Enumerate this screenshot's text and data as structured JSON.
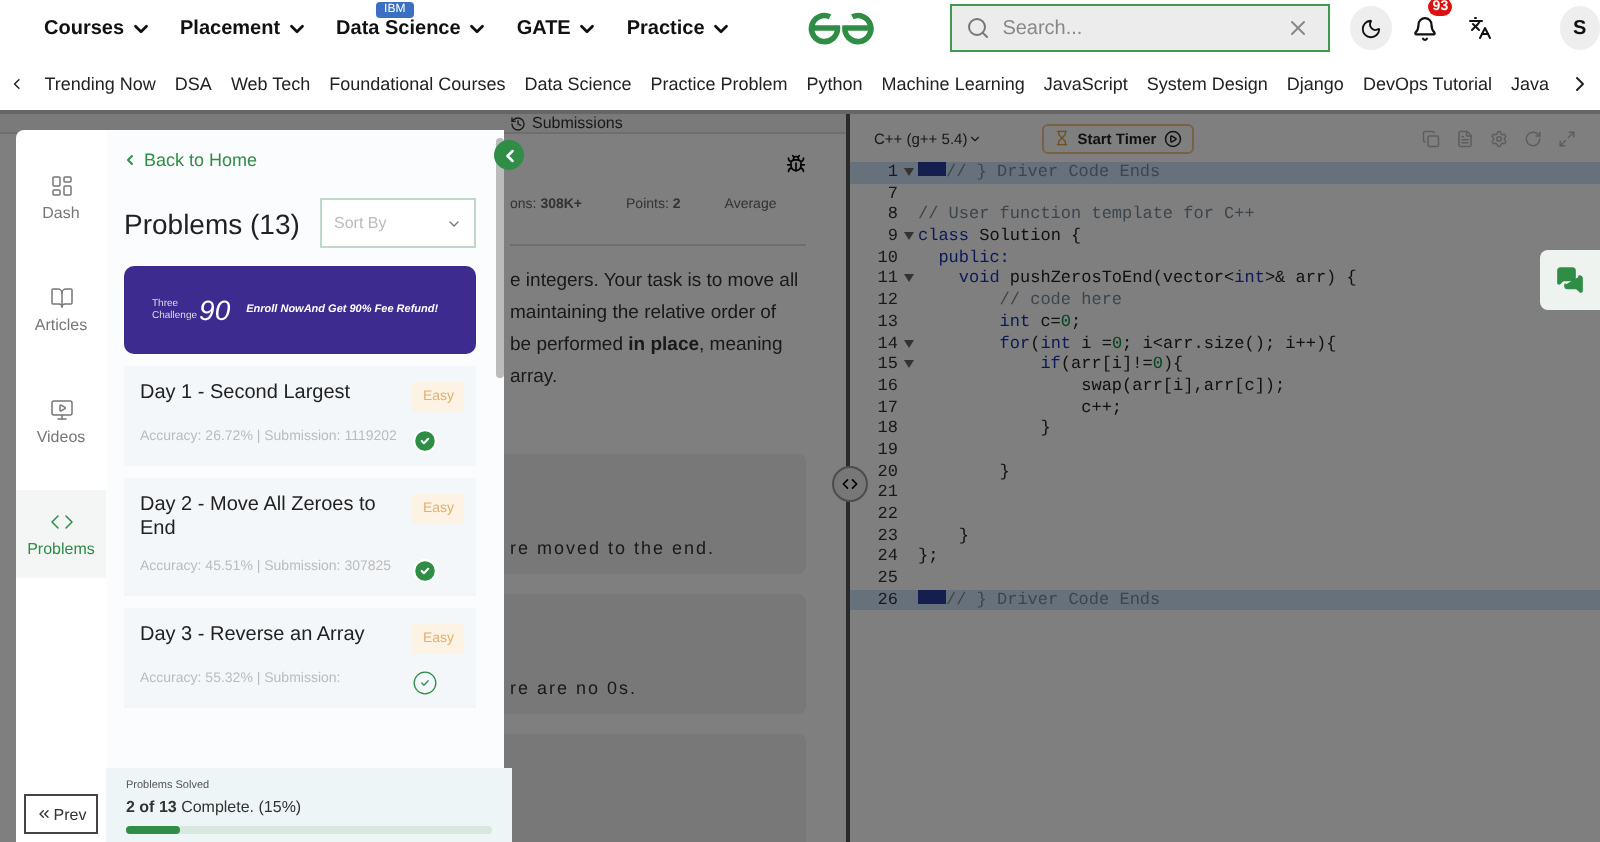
{
  "header": {
    "nav": [
      {
        "label": "Courses"
      },
      {
        "label": "Placement"
      },
      {
        "label": "Data Science",
        "badge": "IBM"
      },
      {
        "label": "GATE"
      },
      {
        "label": "Practice"
      }
    ],
    "search": {
      "placeholder": "Search..."
    },
    "notifications": "93",
    "avatar": "S"
  },
  "topics": [
    "Trending Now",
    "DSA",
    "Web Tech",
    "Foundational Courses",
    "Data Science",
    "Practice Problem",
    "Python",
    "Machine Learning",
    "JavaScript",
    "System Design",
    "Django",
    "DevOps Tutorial",
    "Java"
  ],
  "problem_panel": {
    "tab": "Submissions",
    "stats": [
      "ons: **308K+**",
      "Points: **2**",
      "Average"
    ],
    "description": [
      "e integers. Your task is to move all",
      "maintaining the relative order of",
      "be performed **in place**, meaning",
      "array."
    ],
    "examples": [
      {
        "kind": "text",
        "text": "re moved to the end."
      },
      {
        "kind": "text",
        "text": "re are no 0s."
      },
      {
        "kind": "empty"
      }
    ]
  },
  "editor": {
    "language": "C++ (g++ 5.4)",
    "timer": "Start Timer",
    "lines": [
      {
        "number": "1",
        "fold": true,
        "marker": true,
        "highlighted": true,
        "tokens": [
          {
            "text": "// } Driver Code Ends",
            "kind": "comment"
          }
        ]
      },
      {
        "number": "7",
        "fold": false,
        "marker": false,
        "highlighted": false
      },
      {
        "number": "8",
        "fold": false,
        "marker": false,
        "highlighted": false,
        "tokens": [
          {
            "text": "// User function template for C++",
            "kind": "comment"
          }
        ]
      },
      {
        "number": "9",
        "fold": true,
        "marker": false,
        "highlighted": false,
        "tokens": [
          {
            "text": "class",
            "kind": "keyword"
          },
          {
            "text": " Solution {",
            "kind": "plain"
          }
        ]
      },
      {
        "number": "10",
        "fold": false,
        "marker": false,
        "highlighted": false,
        "tokens": [
          {
            "text": "  public:",
            "kind": "keyword"
          }
        ]
      },
      {
        "number": "11",
        "fold": true,
        "marker": false,
        "highlighted": false,
        "tokens": [
          {
            "text": "    void",
            "kind": "keyword"
          },
          {
            "text": " pushZerosToEnd(vector<",
            "kind": "plain"
          },
          {
            "text": "int",
            "kind": "keyword"
          },
          {
            "text": ">& arr) {",
            "kind": "plain"
          }
        ]
      },
      {
        "number": "12",
        "fold": false,
        "marker": false,
        "highlighted": false,
        "tokens": [
          {
            "text": "        // code here",
            "kind": "comment"
          }
        ]
      },
      {
        "number": "13",
        "fold": false,
        "marker": false,
        "highlighted": false,
        "tokens": [
          {
            "text": "        int",
            "kind": "keyword"
          },
          {
            "text": " c=",
            "kind": "plain"
          },
          {
            "text": "0",
            "kind": "number"
          },
          {
            "text": ";",
            "kind": "plain"
          }
        ]
      },
      {
        "number": "14",
        "fold": true,
        "marker": false,
        "highlighted": false,
        "tokens": [
          {
            "text": "        for",
            "kind": "keyword"
          },
          {
            "text": "(",
            "kind": "plain"
          },
          {
            "text": "int",
            "kind": "keyword"
          },
          {
            "text": " i =",
            "kind": "plain"
          },
          {
            "text": "0",
            "kind": "number"
          },
          {
            "text": "; i<arr.size(); i++){",
            "kind": "plain"
          }
        ]
      },
      {
        "number": "15",
        "fold": true,
        "marker": false,
        "highlighted": false,
        "tokens": [
          {
            "text": "            if",
            "kind": "keyword"
          },
          {
            "text": "(arr[i]!=",
            "kind": "plain"
          },
          {
            "text": "0",
            "kind": "number"
          },
          {
            "text": "){",
            "kind": "plain"
          }
        ]
      },
      {
        "number": "16",
        "fold": false,
        "marker": false,
        "highlighted": false,
        "tokens": [
          {
            "text": "                swap(arr[i],arr[c]);",
            "kind": "plain"
          }
        ]
      },
      {
        "number": "17",
        "fold": false,
        "marker": false,
        "highlighted": false,
        "tokens": [
          {
            "text": "                c++;",
            "kind": "plain"
          }
        ]
      },
      {
        "number": "18",
        "fold": false,
        "marker": false,
        "highlighted": false,
        "tokens": [
          {
            "text": "            }",
            "kind": "plain"
          }
        ]
      },
      {
        "number": "19",
        "fold": false,
        "marker": false,
        "highlighted": false
      },
      {
        "number": "20",
        "fold": false,
        "marker": false,
        "highlighted": false,
        "tokens": [
          {
            "text": "        }",
            "kind": "plain"
          }
        ]
      },
      {
        "number": "21",
        "fold": false,
        "marker": false,
        "highlighted": false
      },
      {
        "number": "22",
        "fold": false,
        "marker": false,
        "highlighted": false
      },
      {
        "number": "23",
        "fold": false,
        "marker": false,
        "highlighted": false,
        "tokens": [
          {
            "text": "    }",
            "kind": "plain"
          }
        ]
      },
      {
        "number": "24",
        "fold": false,
        "marker": false,
        "highlighted": false,
        "tokens": [
          {
            "text": "};",
            "kind": "plain"
          }
        ]
      },
      {
        "number": "25",
        "fold": false,
        "marker": false,
        "highlighted": false
      },
      {
        "number": "26",
        "fold": false,
        "marker": true,
        "highlighted": true,
        "tokens": [
          {
            "text": "// } Driver Code Ends",
            "kind": "comment"
          }
        ]
      }
    ]
  },
  "drawer": {
    "rail": [
      {
        "label": "Dash",
        "selected": false
      },
      {
        "label": "Articles",
        "selected": false
      },
      {
        "label": "Videos",
        "selected": false
      },
      {
        "label": "Problems",
        "selected": true
      }
    ],
    "back": "Back to Home",
    "title": "Problems (13)",
    "sort": {
      "placeholder": "Sort By"
    },
    "banner": {
      "logo_top": "Three",
      "logo_number": "90",
      "logo_bottom": "Challenge",
      "text": "Enroll NowAnd Get 90% Fee Refund!"
    },
    "problems": [
      {
        "title": "Day 1 - Second Largest",
        "difficulty": "Easy",
        "meta": "Accuracy: 26.72% | Submission: 1119202",
        "solved": true
      },
      {
        "title": "Day 2 - Move All Zeroes to End",
        "difficulty": "Easy",
        "meta": "Accuracy: 45.51% | Submission: 307825",
        "solved": true
      },
      {
        "title": "Day 3 - Reverse an Array",
        "difficulty": "Easy",
        "meta": "Accuracy: 55.32% | Submission:",
        "solved": false
      }
    ],
    "prev": "Prev",
    "progress": {
      "label": "Problems Solved",
      "count": "2 of 13",
      "text": " Complete. (15%)",
      "level": 0.15
    }
  }
}
